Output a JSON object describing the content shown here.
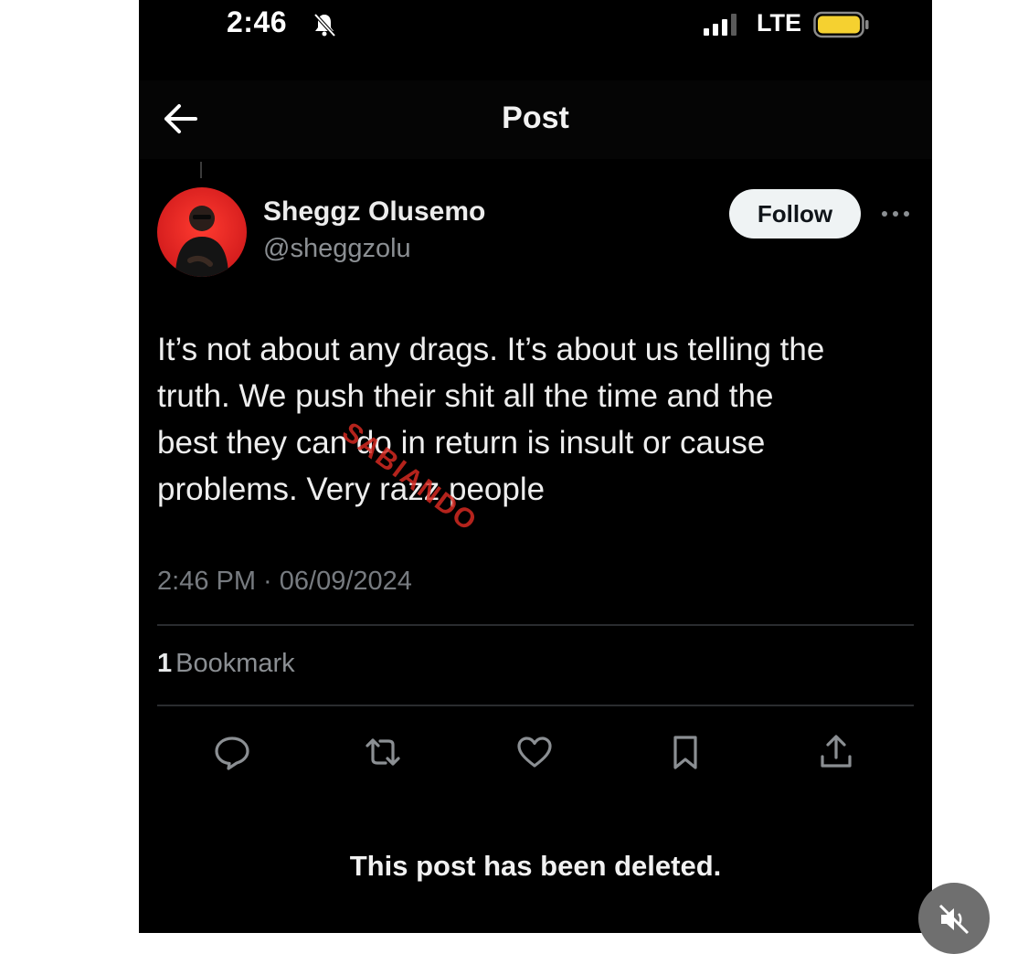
{
  "status_bar": {
    "time": "2:46",
    "network": "LTE",
    "icons": {
      "silent": "bell-slash-icon",
      "signal": "signal-bars-icon",
      "battery": "battery-icon"
    },
    "battery_color": "#f5d130"
  },
  "header": {
    "title": "Post",
    "back_icon": "arrow-left-icon"
  },
  "post": {
    "author": {
      "name": "Sheggz Olusemo",
      "handle": "@sheggzolu"
    },
    "follow_label": "Follow",
    "text": "It’s not about any drags. It’s about us telling the\ntruth. We push their shit all the time and the\nbest they can do in return is insult or cause\nproblems. Very razz people",
    "watermark": "SABIANDO",
    "timestamp": "2:46 PM · 06/09/2024",
    "bookmark_count": "1",
    "bookmark_label": "Bookmark",
    "actions": [
      "reply-icon",
      "repost-icon",
      "like-icon",
      "bookmark-icon",
      "share-icon"
    ]
  },
  "deleted_notice": "This post has been deleted.",
  "colors": {
    "background": "#000000",
    "text": "#e7e9ea",
    "muted": "#8b8f93",
    "watermark": "#d42a22"
  }
}
